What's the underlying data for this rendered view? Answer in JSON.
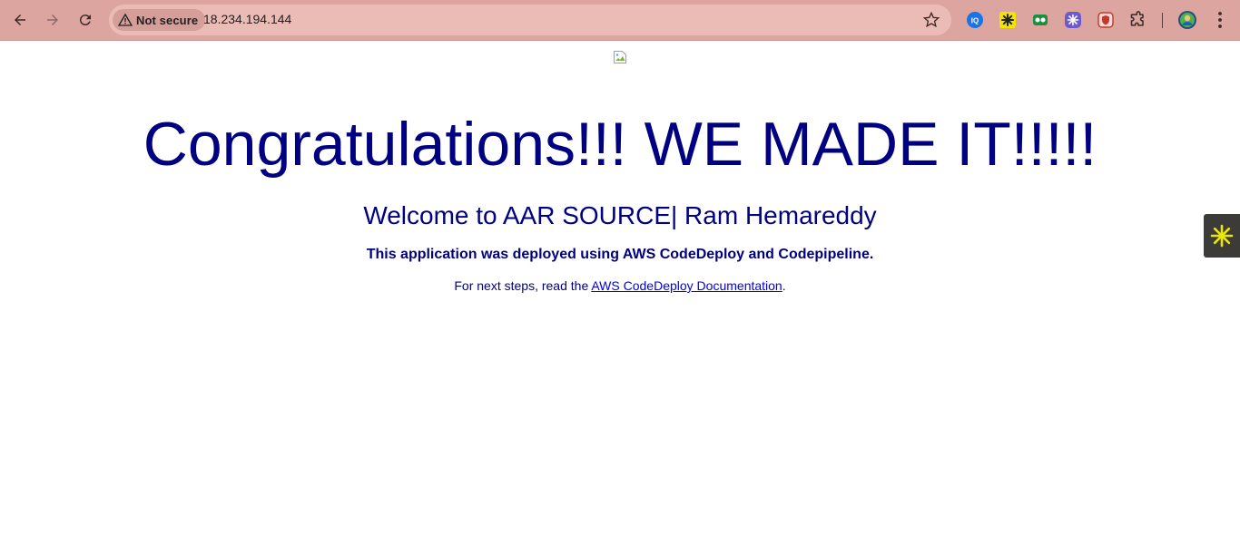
{
  "browser": {
    "security_label": "Not secure",
    "url": "18.234.194.144",
    "extensions": [
      "iq-extension-icon",
      "pinwheel-extension-icon",
      "recorder-extension-icon",
      "snowflake-extension-icon",
      "shield-extension-icon",
      "puzzle-icon"
    ]
  },
  "page": {
    "heading": "Congratulations!!! WE MADE IT!!!!!",
    "subheading": "Welcome to AAR SOURCE| Ram Hemareddy",
    "deploy_note": "This application was deployed using AWS CodeDeploy and Codepipeline.",
    "next_steps_prefix": "For next steps, read the ",
    "next_steps_link": "AWS CodeDeploy Documentation",
    "next_steps_suffix": "."
  },
  "colors": {
    "text": "#000080",
    "link": "#0000ee",
    "toolbar": "#dca5a0"
  }
}
